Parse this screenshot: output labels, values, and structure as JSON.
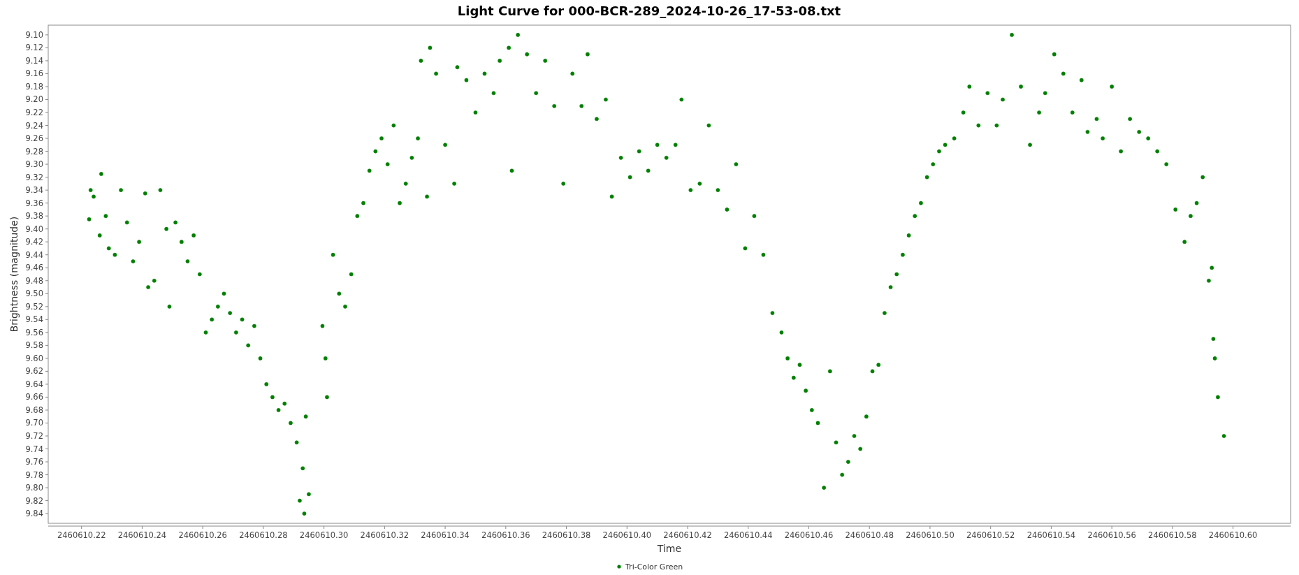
{
  "chart": {
    "chart_data": {
      "type": "scatter",
      "title": "Light Curve for 000-BCR-289_2024-10-26_17-53-08.txt",
      "xlabel": "Time",
      "ylabel": "Brightness (magnitude)",
      "xlim": [
        2460610.209,
        2460610.619
      ],
      "ylim": [
        9.855,
        9.085
      ],
      "xticks": [
        {
          "value": 2460610.22,
          "label": "2460610.22"
        },
        {
          "value": 2460610.24,
          "label": "2460610.24"
        },
        {
          "value": 2460610.26,
          "label": "2460610.26"
        },
        {
          "value": 2460610.28,
          "label": "2460610.28"
        },
        {
          "value": 2460610.3,
          "label": "2460610.30"
        },
        {
          "value": 2460610.32,
          "label": "2460610.32"
        },
        {
          "value": 2460610.34,
          "label": "2460610.34"
        },
        {
          "value": 2460610.36,
          "label": "2460610.36"
        },
        {
          "value": 2460610.38,
          "label": "2460610.38"
        },
        {
          "value": 2460610.4,
          "label": "2460610.40"
        },
        {
          "value": 2460610.42,
          "label": "2460610.42"
        },
        {
          "value": 2460610.44,
          "label": "2460610.44"
        },
        {
          "value": 2460610.46,
          "label": "2460610.46"
        },
        {
          "value": 2460610.48,
          "label": "2460610.48"
        },
        {
          "value": 2460610.5,
          "label": "2460610.50"
        },
        {
          "value": 2460610.52,
          "label": "2460610.52"
        },
        {
          "value": 2460610.54,
          "label": "2460610.54"
        },
        {
          "value": 2460610.56,
          "label": "2460610.56"
        },
        {
          "value": 2460610.58,
          "label": "2460610.58"
        },
        {
          "value": 2460610.6,
          "label": "2460610.60"
        }
      ],
      "yticks": [
        {
          "value": 9.1,
          "label": "9.10"
        },
        {
          "value": 9.12,
          "label": "9.12"
        },
        {
          "value": 9.14,
          "label": "9.14"
        },
        {
          "value": 9.16,
          "label": "9.16"
        },
        {
          "value": 9.18,
          "label": "9.18"
        },
        {
          "value": 9.2,
          "label": "9.20"
        },
        {
          "value": 9.22,
          "label": "9.22"
        },
        {
          "value": 9.24,
          "label": "9.24"
        },
        {
          "value": 9.26,
          "label": "9.26"
        },
        {
          "value": 9.28,
          "label": "9.28"
        },
        {
          "value": 9.3,
          "label": "9.30"
        },
        {
          "value": 9.32,
          "label": "9.32"
        },
        {
          "value": 9.34,
          "label": "9.34"
        },
        {
          "value": 9.36,
          "label": "9.36"
        },
        {
          "value": 9.38,
          "label": "9.38"
        },
        {
          "value": 9.4,
          "label": "9.40"
        },
        {
          "value": 9.42,
          "label": "9.42"
        },
        {
          "value": 9.44,
          "label": "9.44"
        },
        {
          "value": 9.46,
          "label": "9.46"
        },
        {
          "value": 9.48,
          "label": "9.48"
        },
        {
          "value": 9.5,
          "label": "9.50"
        },
        {
          "value": 9.52,
          "label": "9.52"
        },
        {
          "value": 9.54,
          "label": "9.54"
        },
        {
          "value": 9.56,
          "label": "9.56"
        },
        {
          "value": 9.58,
          "label": "9.58"
        },
        {
          "value": 9.6,
          "label": "9.60"
        },
        {
          "value": 9.62,
          "label": "9.62"
        },
        {
          "value": 9.64,
          "label": "9.64"
        },
        {
          "value": 9.66,
          "label": "9.66"
        },
        {
          "value": 9.68,
          "label": "9.68"
        },
        {
          "value": 9.7,
          "label": "9.70"
        },
        {
          "value": 9.72,
          "label": "9.72"
        },
        {
          "value": 9.74,
          "label": "9.74"
        },
        {
          "value": 9.76,
          "label": "9.76"
        },
        {
          "value": 9.78,
          "label": "9.78"
        },
        {
          "value": 9.8,
          "label": "9.80"
        },
        {
          "value": 9.82,
          "label": "9.82"
        },
        {
          "value": 9.84,
          "label": "9.84"
        }
      ],
      "x": [
        2460610.2225,
        2460610.223,
        2460610.224,
        2460610.226,
        2460610.2265,
        2460610.228,
        2460610.229,
        2460610.231,
        2460610.233,
        2460610.235,
        2460610.237,
        2460610.239,
        2460610.241,
        2460610.242,
        2460610.244,
        2460610.246,
        2460610.248,
        2460610.249,
        2460610.251,
        2460610.253,
        2460610.255,
        2460610.257,
        2460610.259,
        2460610.261,
        2460610.263,
        2460610.265,
        2460610.267,
        2460610.269,
        2460610.271,
        2460610.273,
        2460610.275,
        2460610.277,
        2460610.279,
        2460610.281,
        2460610.283,
        2460610.285,
        2460610.287,
        2460610.289,
        2460610.291,
        2460610.292,
        2460610.293,
        2460610.2935,
        2460610.294,
        2460610.295,
        2460610.2995,
        2460610.3005,
        2460610.301,
        2460610.303,
        2460610.305,
        2460610.307,
        2460610.309,
        2460610.311,
        2460610.313,
        2460610.315,
        2460610.317,
        2460610.319,
        2460610.321,
        2460610.323,
        2460610.325,
        2460610.327,
        2460610.329,
        2460610.331,
        2460610.332,
        2460610.334,
        2460610.335,
        2460610.337,
        2460610.34,
        2460610.343,
        2460610.344,
        2460610.347,
        2460610.35,
        2460610.353,
        2460610.356,
        2460610.358,
        2460610.361,
        2460610.362,
        2460610.364,
        2460610.367,
        2460610.37,
        2460610.373,
        2460610.376,
        2460610.379,
        2460610.382,
        2460610.385,
        2460610.387,
        2460610.39,
        2460610.393,
        2460610.395,
        2460610.398,
        2460610.401,
        2460610.404,
        2460610.407,
        2460610.41,
        2460610.413,
        2460610.416,
        2460610.418,
        2460610.421,
        2460610.424,
        2460610.427,
        2460610.43,
        2460610.433,
        2460610.436,
        2460610.439,
        2460610.442,
        2460610.445,
        2460610.448,
        2460610.451,
        2460610.453,
        2460610.455,
        2460610.457,
        2460610.459,
        2460610.461,
        2460610.463,
        2460610.465,
        2460610.467,
        2460610.469,
        2460610.471,
        2460610.473,
        2460610.475,
        2460610.477,
        2460610.479,
        2460610.481,
        2460610.483,
        2460610.485,
        2460610.487,
        2460610.489,
        2460610.491,
        2460610.493,
        2460610.495,
        2460610.497,
        2460610.499,
        2460610.501,
        2460610.503,
        2460610.505,
        2460610.508,
        2460610.511,
        2460610.513,
        2460610.516,
        2460610.519,
        2460610.522,
        2460610.524,
        2460610.527,
        2460610.53,
        2460610.533,
        2460610.536,
        2460610.538,
        2460610.541,
        2460610.544,
        2460610.547,
        2460610.55,
        2460610.552,
        2460610.555,
        2460610.557,
        2460610.56,
        2460610.563,
        2460610.566,
        2460610.569,
        2460610.572,
        2460610.575,
        2460610.578,
        2460610.581,
        2460610.584,
        2460610.586,
        2460610.588,
        2460610.59,
        2460610.592,
        2460610.593,
        2460610.5935,
        2460610.594,
        2460610.595,
        2460610.597
      ],
      "series": [
        {
          "name": "Tri-Color Green",
          "color": "#008000",
          "values": [
            9.385,
            9.34,
            9.35,
            9.41,
            9.315,
            9.38,
            9.43,
            9.44,
            9.34,
            9.39,
            9.45,
            9.42,
            9.345,
            9.49,
            9.48,
            9.34,
            9.4,
            9.52,
            9.39,
            9.42,
            9.45,
            9.41,
            9.47,
            9.56,
            9.54,
            9.52,
            9.5,
            9.53,
            9.56,
            9.54,
            9.58,
            9.55,
            9.6,
            9.64,
            9.66,
            9.68,
            9.67,
            9.7,
            9.73,
            9.82,
            9.77,
            9.84,
            9.69,
            9.81,
            9.55,
            9.6,
            9.66,
            9.44,
            9.5,
            9.52,
            9.47,
            9.38,
            9.36,
            9.31,
            9.28,
            9.26,
            9.3,
            9.24,
            9.36,
            9.33,
            9.29,
            9.26,
            9.14,
            9.35,
            9.12,
            9.16,
            9.27,
            9.33,
            9.15,
            9.17,
            9.22,
            9.16,
            9.19,
            9.14,
            9.12,
            9.31,
            9.1,
            9.13,
            9.19,
            9.14,
            9.21,
            9.33,
            9.16,
            9.21,
            9.13,
            9.23,
            9.2,
            9.35,
            9.29,
            9.32,
            9.28,
            9.31,
            9.27,
            9.29,
            9.27,
            9.2,
            9.34,
            9.33,
            9.24,
            9.34,
            9.37,
            9.3,
            9.43,
            9.38,
            9.44,
            9.53,
            9.56,
            9.6,
            9.63,
            9.61,
            9.65,
            9.68,
            9.7,
            9.8,
            9.62,
            9.73,
            9.78,
            9.76,
            9.72,
            9.74,
            9.69,
            9.62,
            9.61,
            9.53,
            9.49,
            9.47,
            9.44,
            9.41,
            9.38,
            9.36,
            9.32,
            9.3,
            9.28,
            9.27,
            9.26,
            9.22,
            9.18,
            9.24,
            9.19,
            9.24,
            9.2,
            9.1,
            9.18,
            9.27,
            9.22,
            9.19,
            9.13,
            9.16,
            9.22,
            9.17,
            9.25,
            9.23,
            9.26,
            9.18,
            9.28,
            9.23,
            9.25,
            9.26,
            9.28,
            9.3,
            9.37,
            9.42,
            9.38,
            9.36,
            9.32,
            9.48,
            9.46,
            9.57,
            9.6,
            9.66,
            9.72
          ]
        }
      ]
    }
  }
}
